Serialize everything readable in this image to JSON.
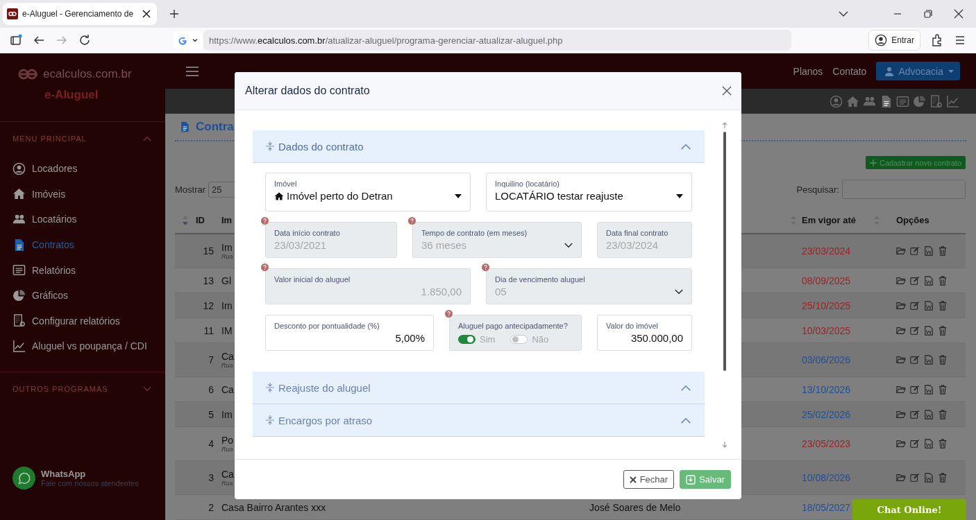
{
  "browser": {
    "tab_title": "e-Aluguel - Gerenciamento de",
    "url": {
      "prefix": "https://www.",
      "domain": "ecalculos.com.br",
      "path": "/atualizar-aluguel/programa-gerenciar-atualizar-aluguel.php"
    },
    "profile_button": "Entrar"
  },
  "site": {
    "logo": "ecalculos.com.br",
    "app_name": "e-Aluguel",
    "nav": [
      "Planos",
      "Contato"
    ],
    "user_button": "Advocacia"
  },
  "sidebar": {
    "sections": [
      {
        "title": "MENU PRINCIPAL",
        "expanded": true,
        "items": [
          {
            "label": "Locadores",
            "selected": false
          },
          {
            "label": "Imóveis",
            "selected": false
          },
          {
            "label": "Locatários",
            "selected": false
          },
          {
            "label": "Contratos",
            "selected": true
          },
          {
            "label": "Relatórios",
            "selected": false
          },
          {
            "label": "Gráficos",
            "selected": false
          },
          {
            "label": "Configurar relatórios",
            "selected": false
          },
          {
            "label": "Aluguel vs poupança / CDI",
            "selected": false
          }
        ]
      },
      {
        "title": "OUTROS PROGRAMAS",
        "expanded": false
      }
    ],
    "whatsapp": {
      "title": "WhatsApp",
      "subtitle": "Fale com nossos atendentes"
    }
  },
  "content": {
    "heading": "Contra",
    "add_button": "Cadastrar novo contrato",
    "show_label": "Mostrar",
    "page_size": "25",
    "search_label": "Pesquisar:",
    "table": {
      "columns": [
        "ID",
        "Im",
        "Em vigor até",
        "Opções"
      ],
      "rows": [
        {
          "id": "15",
          "name": "Im",
          "sub": "Rua",
          "date": "23/03/2024",
          "color": "#9b2226"
        },
        {
          "id": "13",
          "name": "Gl",
          "date": "08/09/2025",
          "color": "#9b2226"
        },
        {
          "id": "12",
          "name": "Im",
          "date": "25/10/2025",
          "color": "#9b2226"
        },
        {
          "id": "11",
          "name": "IM",
          "date": "10/03/2025",
          "color": "#9b2226"
        },
        {
          "id": "7",
          "name": "Ca",
          "sub": "Rua",
          "date": "03/06/2026",
          "color": "#1f4f99"
        },
        {
          "id": "6",
          "name": "Ca",
          "date": "13/10/2026",
          "color": "#1f4f99"
        },
        {
          "id": "5",
          "name": "Im",
          "date": "25/02/2026",
          "color": "#1f4f99"
        },
        {
          "id": "4",
          "name": "Po",
          "sub": "Rua",
          "date": "23/05/2023",
          "color": "#9b2226"
        },
        {
          "id": "3",
          "name": "Ca",
          "sub": "Rua",
          "date": "10/08/2026",
          "color": "#1f4f99"
        },
        {
          "id": "2",
          "name": "Casa Bairro Arantes xxx",
          "tenant": "José Soares de Melo",
          "date": "18/05/2027",
          "color": "#1f4f99"
        }
      ]
    }
  },
  "chat_button": "Chat Online!",
  "modal": {
    "title": "Alterar dados do contrato",
    "sections": [
      {
        "title": "Dados do contrato",
        "expanded": true
      },
      {
        "title": "Reajuste do aluguel",
        "expanded": false
      },
      {
        "title": "Encargos por atraso",
        "expanded": false
      }
    ],
    "field_rows": [
      [
        {
          "kind": "select",
          "label": "Imóvel",
          "value": "Imóvel perto do Detran",
          "house": true,
          "disabled": false,
          "help": false
        },
        {
          "kind": "select",
          "label": "Inquilino (locatário)",
          "value": "LOCATÁRIO testar reajuste",
          "disabled": false,
          "help": false
        }
      ],
      [
        {
          "kind": "text",
          "label": "Data início contrato",
          "value": "23/03/2021",
          "disabled": true,
          "help": true
        },
        {
          "kind": "dropdown",
          "label": "Tempo de contrato (em meses)",
          "value": "36 meses",
          "disabled": true,
          "help": true
        },
        {
          "kind": "text",
          "label": "Data final contrato",
          "value": "23/03/2024",
          "disabled": true,
          "help": false
        }
      ],
      [
        {
          "kind": "number",
          "label": "Valor inicial do aluguel",
          "value": "1.850,00",
          "disabled": true,
          "help": true
        },
        {
          "kind": "dropdown",
          "label": "Dia de vencimento aluguel",
          "value": "05",
          "disabled": true,
          "help": true
        }
      ],
      [
        {
          "kind": "number",
          "label": "Desconto por pontualidade (%)",
          "value": "5,00%",
          "disabled": false,
          "help": false
        },
        {
          "kind": "toggles",
          "label": "Aluguel pago antecipadamente?",
          "disabled": true,
          "help": true,
          "options": [
            {
              "label": "Sim",
              "on": true
            },
            {
              "label": "Não",
              "on": false
            }
          ]
        },
        {
          "kind": "number",
          "label": "Valor do imóvel",
          "value": "350.000,00",
          "disabled": false,
          "help": false
        }
      ]
    ],
    "buttons": [
      {
        "label": "Fechar",
        "kind": "secondary"
      },
      {
        "label": "Salvar",
        "kind": "primary"
      }
    ]
  }
}
